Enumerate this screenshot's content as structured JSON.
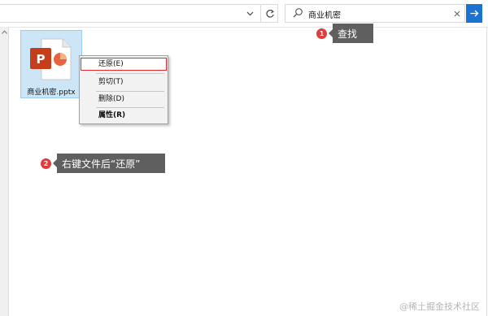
{
  "toolbar": {
    "search_value": "商业机密",
    "search_icon": "search-icon",
    "clear_icon": "close-icon",
    "go_icon": "arrow-right-icon",
    "refresh_icon": "refresh-icon",
    "dropdown_icon": "chevron-down-icon",
    "accent_color": "#1b73d1"
  },
  "file": {
    "name": "商业机密.pptx",
    "icon": "powerpoint-file-icon",
    "brand_color": "#c43e1c"
  },
  "context_menu": {
    "items": [
      {
        "label": "还原(E)",
        "highlighted": true
      },
      {
        "label": "剪切(T)"
      },
      {
        "label": "删除(D)"
      },
      {
        "label": "属性(R)",
        "bold": true
      }
    ]
  },
  "annotations": {
    "step1": {
      "number": "1",
      "text": "查找"
    },
    "step2": {
      "number": "2",
      "text": "右键文件后“还原”"
    },
    "badge_color": "#e23b3b",
    "callout_color": "#5f5f5f"
  },
  "watermark": "@稀土掘金技术社区"
}
